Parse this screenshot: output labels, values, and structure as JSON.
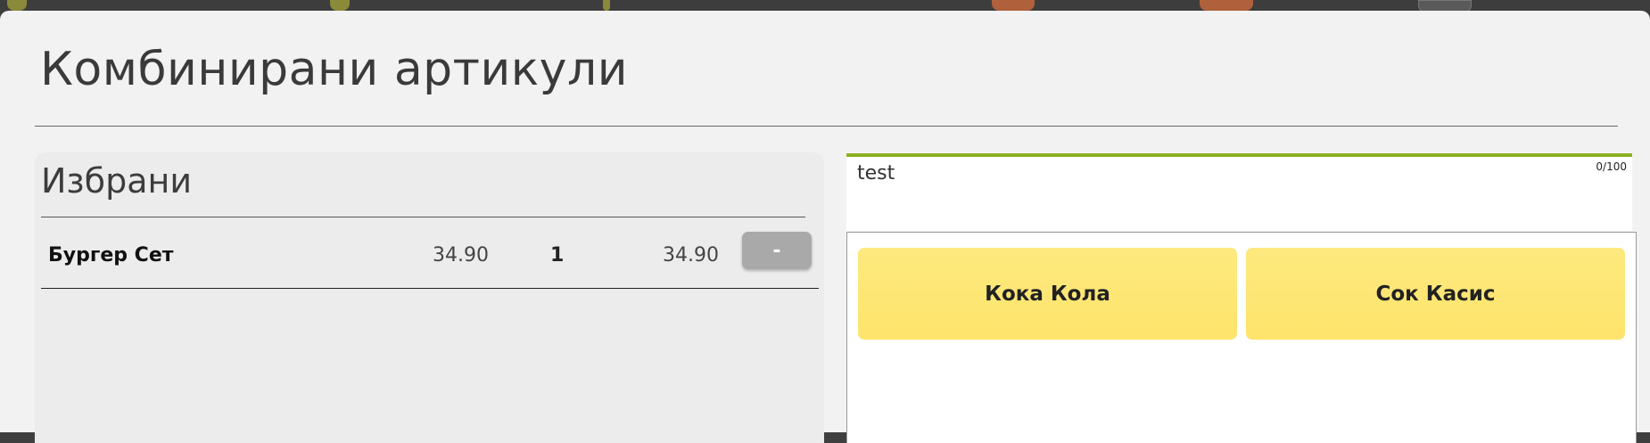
{
  "modal": {
    "title": "Комбинирани артикули"
  },
  "selected": {
    "heading": "Избрани",
    "items": [
      {
        "name": "Бургер Сет",
        "price": "34.90",
        "qty": "1",
        "total": "34.90",
        "remove_label": "-"
      }
    ]
  },
  "note": {
    "value": "test",
    "counter": "0/100"
  },
  "options": [
    {
      "label": "Кока Кола"
    },
    {
      "label": "Сок Касис"
    }
  ],
  "colors": {
    "accent": "#8bb21f",
    "option_button": "#fee46b",
    "remove_button": "#a9a9a9",
    "modal_background": "#f2f2f2"
  }
}
